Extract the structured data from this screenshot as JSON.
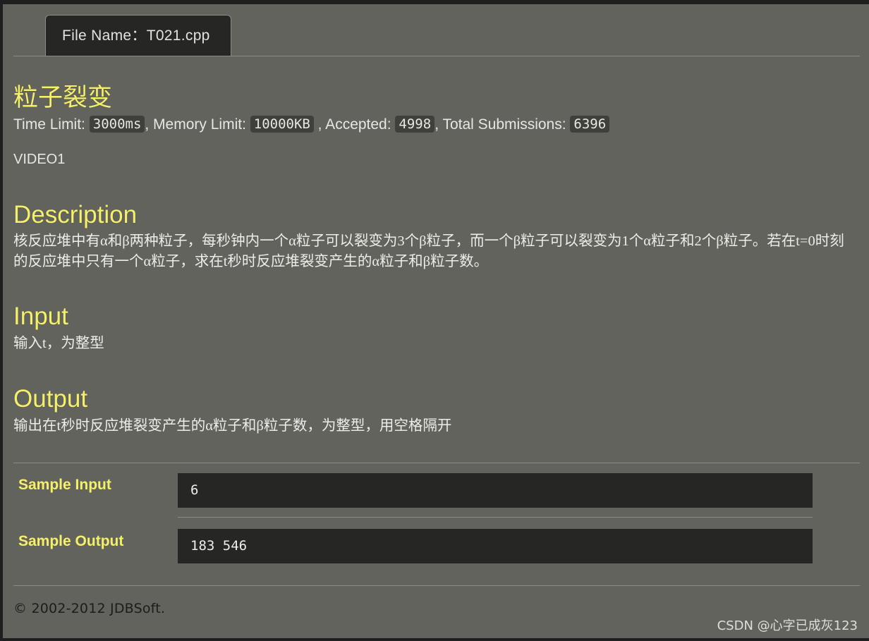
{
  "tab": {
    "label": "File Name：T021.cpp"
  },
  "problem": {
    "title": "粒子裂变",
    "stats": {
      "time_limit_label": "Time Limit:",
      "time_limit_value": "3000ms",
      "memory_limit_label": ", Memory Limit:",
      "memory_limit_value": "10000KB",
      "accepted_label": ", Accepted:",
      "accepted_value": "4998",
      "total_label": ", Total Submissions:",
      "total_value": "6396"
    },
    "video_label": "VIDEO1"
  },
  "sections": {
    "description": {
      "heading": "Description",
      "text": "核反应堆中有α和β两种粒子，每秒钟内一个α粒子可以裂变为3个β粒子，而一个β粒子可以裂变为1个α粒子和2个β粒子。若在t=0时刻的反应堆中只有一个α粒子，求在t秒时反应堆裂变产生的α粒子和β粒子数。"
    },
    "input": {
      "heading": "Input",
      "text": "输入t，为整型"
    },
    "output": {
      "heading": "Output",
      "text": "输出在t秒时反应堆裂变产生的α粒子和β粒子数，为整型，用空格隔开"
    }
  },
  "samples": {
    "input_label": "Sample Input",
    "input_value": "6",
    "output_label": "Sample Output",
    "output_value": "183 546"
  },
  "footer": {
    "copyright": "© 2002-2012  JDBSoft.",
    "watermark": "CSDN @心字已成灰123"
  },
  "colors": {
    "page_background": "#63635d",
    "heading_yellow": "#f5f06a",
    "code_box_background": "#262624",
    "text": "#e6e6e2"
  }
}
